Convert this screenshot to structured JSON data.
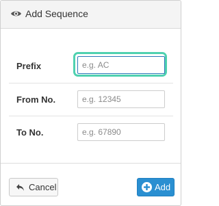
{
  "dialog": {
    "title": "Add Sequence",
    "title_icon": "eye-icon"
  },
  "fields": [
    {
      "label": "Prefix",
      "placeholder": "e.g. AC",
      "value": ""
    },
    {
      "label": "From No.",
      "placeholder": "e.g. 12345",
      "value": ""
    },
    {
      "label": "To No.",
      "placeholder": "e.g. 67890",
      "value": ""
    }
  ],
  "footer": {
    "cancel_label": "Cancel",
    "cancel_icon": "undo-arrow-icon",
    "add_label": "Add",
    "add_icon": "plus-circle-icon"
  },
  "colors": {
    "focus_ring": "#4fd1b0",
    "primary": "#2a8fd1",
    "header_bg": "#f4f4f4"
  }
}
